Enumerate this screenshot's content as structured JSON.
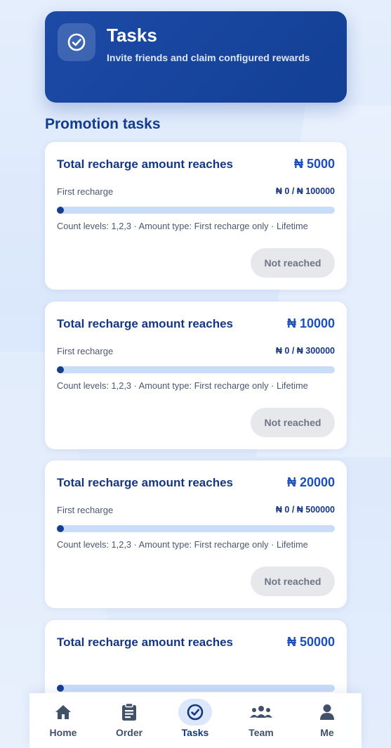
{
  "header": {
    "title": "Tasks",
    "subtitle": "Invite friends and claim configured rewards",
    "icon": "check-circle-icon"
  },
  "section": {
    "title": "Promotion tasks"
  },
  "cards": [
    {
      "title": "Total recharge amount reaches",
      "amount": "₦ 5000",
      "label": "First recharge",
      "progress": "₦ 0 / ₦ 100000",
      "progress_fraction": 0,
      "meta": "Count levels: 1,2,3 · Amount type: First recharge only · Lifetime",
      "button": "Not reached"
    },
    {
      "title": "Total recharge amount reaches",
      "amount": "₦ 10000",
      "label": "First recharge",
      "progress": "₦ 0 / ₦ 300000",
      "progress_fraction": 0,
      "meta": "Count levels: 1,2,3 · Amount type: First recharge only · Lifetime",
      "button": "Not reached"
    },
    {
      "title": "Total recharge amount reaches",
      "amount": "₦ 20000",
      "label": "First recharge",
      "progress": "₦ 0 / ₦ 500000",
      "progress_fraction": 0,
      "meta": "Count levels: 1,2,3 · Amount type: First recharge only · Lifetime",
      "button": "Not reached"
    },
    {
      "title": "Total recharge amount reaches",
      "amount": "₦ 50000",
      "progress_fraction": 0
    }
  ],
  "nav": [
    {
      "label": "Home",
      "icon": "home-icon",
      "active": false
    },
    {
      "label": "Order",
      "icon": "clipboard-icon",
      "active": false
    },
    {
      "label": "Tasks",
      "icon": "check-circle-icon",
      "active": true
    },
    {
      "label": "Team",
      "icon": "team-icon",
      "active": false
    },
    {
      "label": "Me",
      "icon": "user-icon",
      "active": false
    }
  ],
  "colors": {
    "primary": "#163780",
    "header_bg": "#1c4aa6",
    "amount": "#1d4fba",
    "bar_track": "#c9dcf8",
    "bar_fill": "#173d8e",
    "button_bg": "#e6e8ec"
  }
}
